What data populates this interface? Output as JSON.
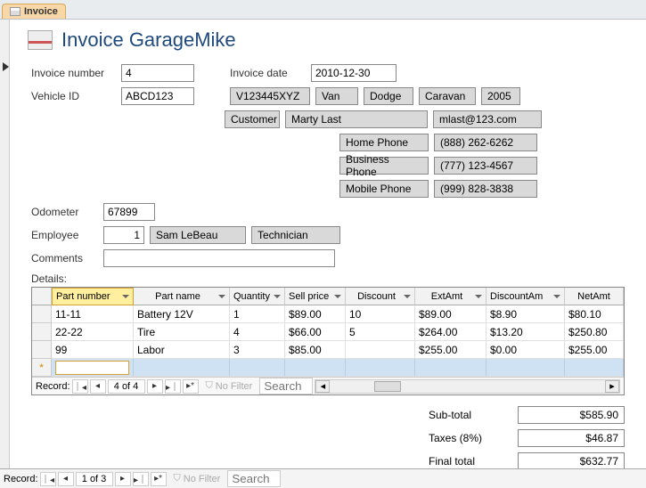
{
  "tab": {
    "label": "Invoice"
  },
  "header": {
    "title": "Invoice GarageMike"
  },
  "fields": {
    "invoice_number_label": "Invoice number",
    "invoice_number": "4",
    "invoice_date_label": "Invoice date",
    "invoice_date": "2010-12-30",
    "vehicle_id_label": "Vehicle ID",
    "vehicle_id": "ABCD123",
    "vin": "V123445XYZ",
    "veh_type": "Van",
    "veh_make": "Dodge",
    "veh_model": "Caravan",
    "veh_year": "2005",
    "customer_label": "Customer",
    "customer_name": "Marty Last",
    "customer_email": "mlast@123.com",
    "home_phone_label": "Home Phone",
    "home_phone": "(888) 262-6262",
    "business_phone_label": "Business Phone",
    "business_phone": "(777) 123-4567",
    "mobile_phone_label": "Mobile Phone",
    "mobile_phone": "(999) 828-3838",
    "odometer_label": "Odometer",
    "odometer": "67899",
    "employee_label": "Employee",
    "employee_id": "1",
    "employee_name": "Sam LeBeau",
    "employee_title": "Technician",
    "comments_label": "Comments",
    "comments": ""
  },
  "details": {
    "label": "Details:",
    "columns": {
      "part_number": "Part number",
      "part_name": "Part name",
      "quantity": "Quantity",
      "sell_price": "Sell price",
      "discount": "Discount",
      "ext_amt": "ExtAmt",
      "discount_amt": "DiscountAm",
      "net_amt": "NetAmt"
    },
    "rows": [
      {
        "part": "11-11",
        "name": "Battery 12V",
        "qty": "1",
        "sell": "$89.00",
        "disc": "10",
        "ext": "$89.00",
        "discamt": "$8.90",
        "net": "$80.10"
      },
      {
        "part": "22-22",
        "name": "Tire",
        "qty": "4",
        "sell": "$66.00",
        "disc": "5",
        "ext": "$264.00",
        "discamt": "$13.20",
        "net": "$250.80"
      },
      {
        "part": "99",
        "name": "Labor",
        "qty": "3",
        "sell": "$85.00",
        "disc": "",
        "ext": "$255.00",
        "discamt": "$0.00",
        "net": "$255.00"
      }
    ],
    "nav": {
      "record_label": "Record:",
      "position": "4 of 4",
      "no_filter": "No Filter",
      "search_placeholder": "Search"
    }
  },
  "totals": {
    "subtotal_label": "Sub-total",
    "subtotal": "$585.90",
    "taxes_label": "Taxes (8%)",
    "taxes": "$46.87",
    "final_label": "Final total",
    "final": "$632.77"
  },
  "outer_nav": {
    "record_label": "Record:",
    "position": "1 of 3",
    "no_filter": "No Filter",
    "search_placeholder": "Search"
  }
}
